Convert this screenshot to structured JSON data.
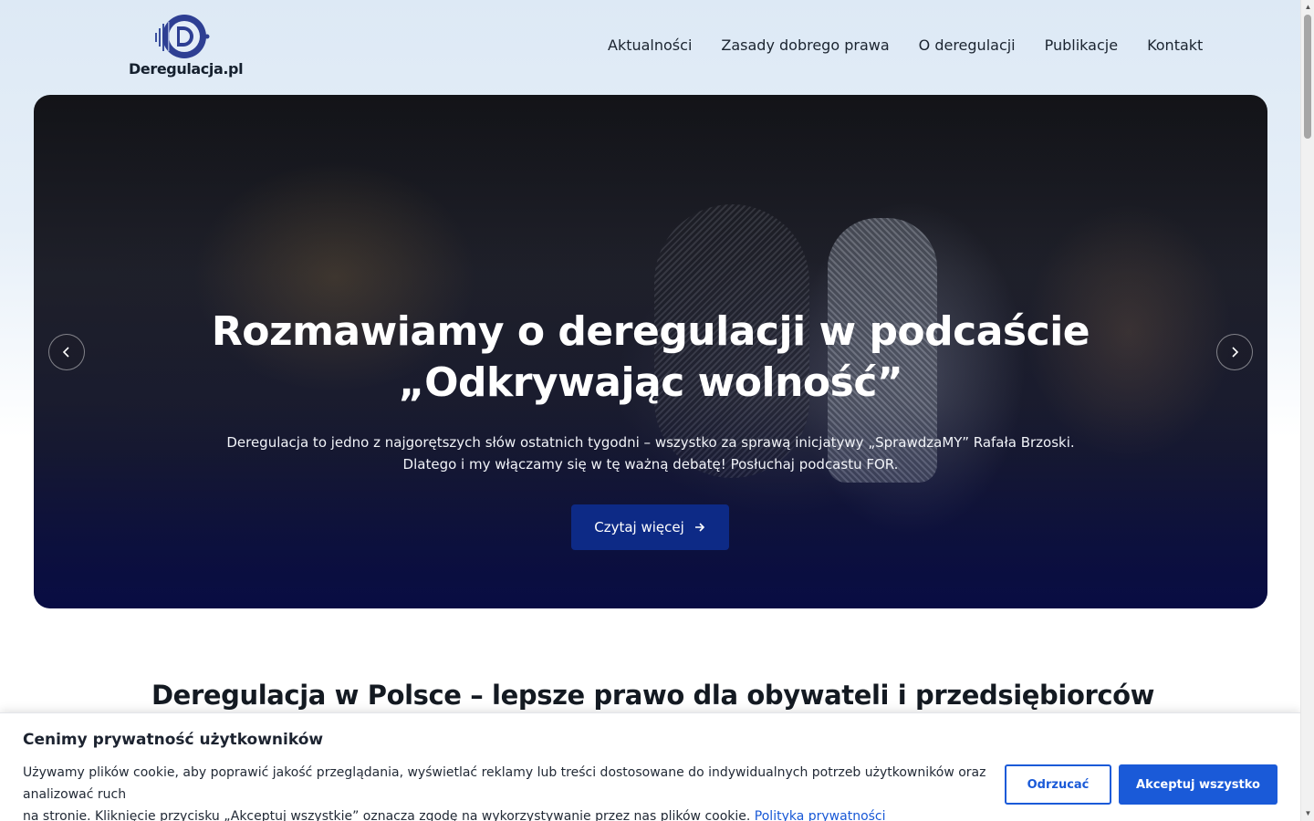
{
  "header": {
    "logo_text": "Deregulacja.pl",
    "logo_icon": "d-circle-logo-icon",
    "nav": [
      {
        "label": "Aktualności"
      },
      {
        "label": "Zasady dobrego prawa"
      },
      {
        "label": "O deregulacji"
      },
      {
        "label": "Publikacje"
      },
      {
        "label": "Kontakt"
      }
    ]
  },
  "hero": {
    "title_line1": "Rozmawiamy o deregulacji w podcaście",
    "title_line2": "„Odkrywając wolność”",
    "text_line1": "Deregulacja to jedno z najgorętszych słów ostatnich tygodni – wszystko za sprawą inicjatywy „SprawdzaMY” Rafała Brzoski.",
    "text_line2": "Dlatego i my włączamy się w tę ważną debatę! Posłuchaj podcastu FOR.",
    "button_label": "Czytaj więcej",
    "button_icon": "arrow-right-icon",
    "prev_icon": "chevron-left-icon",
    "next_icon": "chevron-right-icon",
    "accent_color": "#0d2a86"
  },
  "section": {
    "title": "Deregulacja w Polsce – lepsze prawo dla obywateli i przedsiębiorców"
  },
  "cookie": {
    "title": "Cenimy prywatność użytkowników",
    "text_line1": "Używamy plików cookie, aby poprawić jakość przeglądania, wyświetlać reklamy lub treści dostosowane do indywidualnych potrzeb użytkowników oraz analizować ruch",
    "text_line2": "na stronie. Kliknięcie przycisku „Akceptuj wszystkie” oznacza zgodę na wykorzystywanie przez nas plików cookie.",
    "link_label": "Polityka prywatności",
    "reject_label": "Odrzucać",
    "accept_label": "Akceptuj wszystko",
    "accent_color": "#1a5ad8"
  }
}
